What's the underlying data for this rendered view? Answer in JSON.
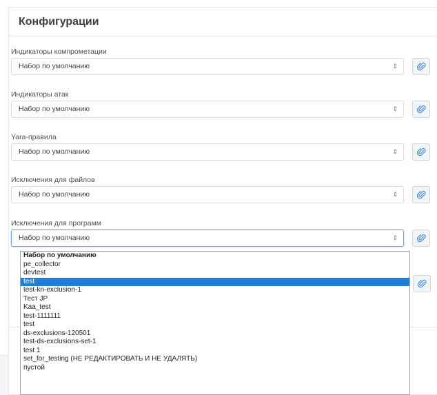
{
  "panel": {
    "title": "Конфигурации"
  },
  "fields": [
    {
      "label": "Индикаторы компрометации",
      "value": "Набор по умолчанию"
    },
    {
      "label": "Индикаторы атак",
      "value": "Набор по умолчанию"
    },
    {
      "label": "Yara-правила",
      "value": "Набор по умолчанию"
    },
    {
      "label": "Исключения для файлов",
      "value": "Набор по умолчанию"
    },
    {
      "label": "Исключения для программ",
      "value": "Набор по умолчанию"
    }
  ],
  "dropdown": {
    "options": [
      "Набор по умолчанию",
      "pe_collector",
      "devtest",
      "test",
      "test-kn-exclusion-1",
      "Тест JP",
      "Kaa_test",
      "test-1111111",
      "test",
      "ds-exclusions-120501",
      "test-ds-exclusions-set-1",
      "test 1",
      "set_for_testing (НЕ РЕДАКТИРОВАТЬ И НЕ УДАЛЯТЬ)",
      "пустой"
    ],
    "selected_index": 3,
    "bold_index": 0
  },
  "icons": {
    "attach": "paperclip-icon",
    "sort": "sort-arrows-icon"
  },
  "colors": {
    "accent": "#1e7fd8",
    "icon": "#4a8fd6"
  }
}
